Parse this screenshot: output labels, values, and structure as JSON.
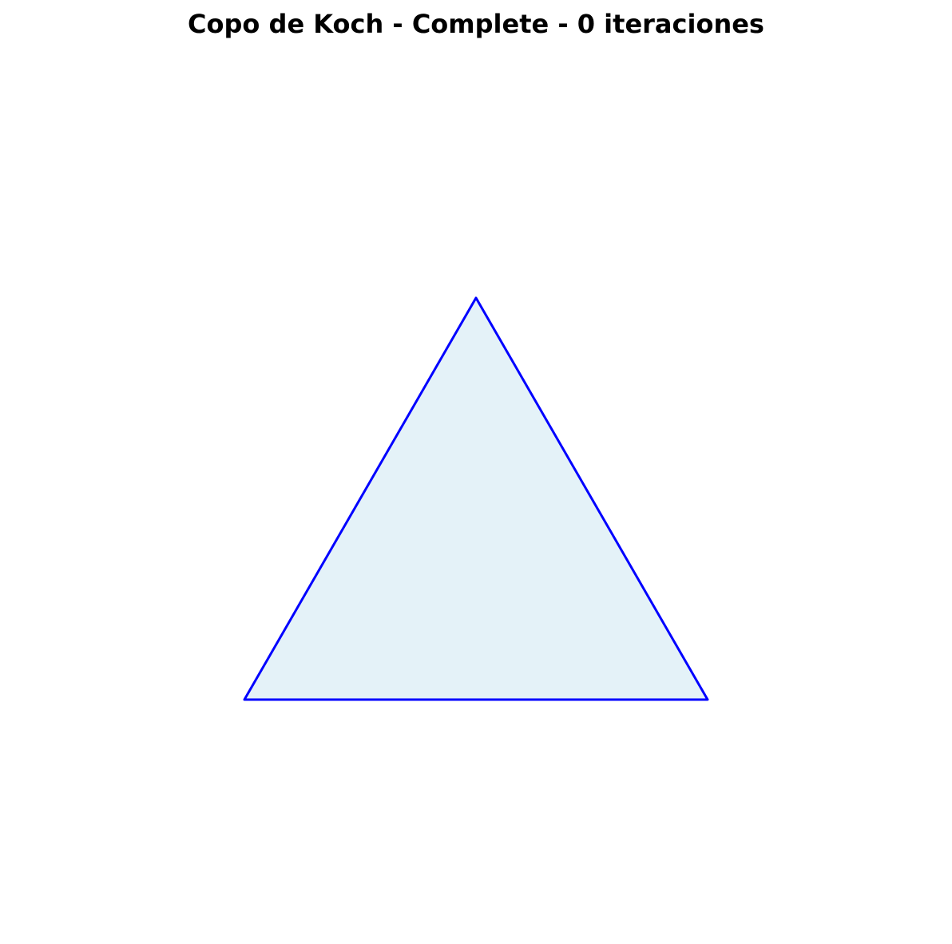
{
  "figure": {
    "title": "Copo de Koch - Complete - 0 iteraciones"
  },
  "shape": {
    "fill_color": "#e4f2f8",
    "stroke_color": "#0000ff"
  }
}
